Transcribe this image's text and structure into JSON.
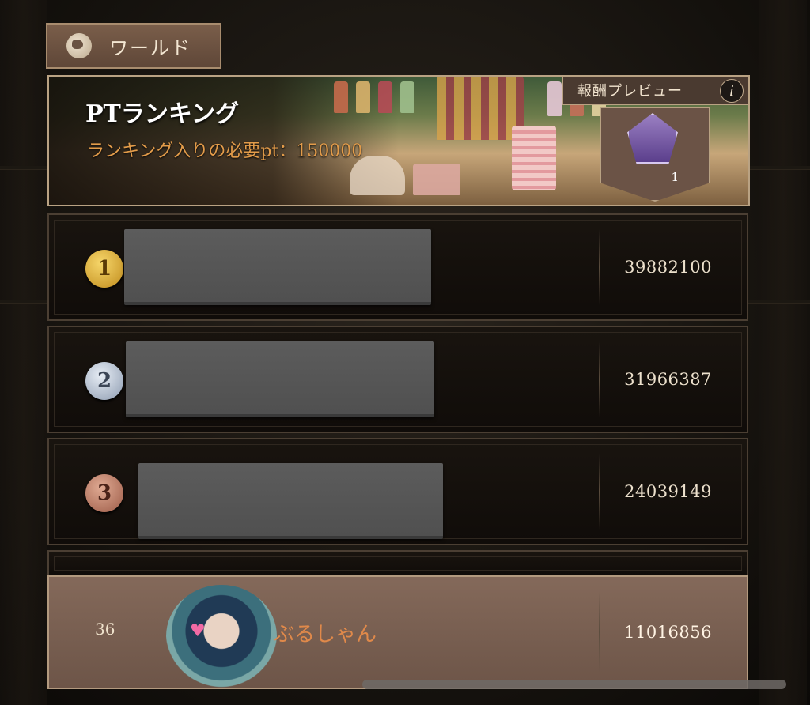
{
  "tab": {
    "label": "ワールド",
    "icon": "globe-icon"
  },
  "banner": {
    "title": "PTランキング",
    "subtitle": "ランキング入りの必要pt：150000",
    "reward_label": "報酬プレビュー",
    "info_glyph": "i",
    "reward_icon": "cake-badge-icon",
    "reward_count": "1"
  },
  "rankings": [
    {
      "rank": "1",
      "score": "39882100"
    },
    {
      "rank": "2",
      "score": "31966387"
    },
    {
      "rank": "3",
      "score": "24039149"
    }
  ],
  "self": {
    "rank": "36",
    "name": "ぶるしゃん",
    "score": "11016856"
  },
  "colors": {
    "accent_orange": "#e0894a",
    "banner_subtitle": "#e39c4a",
    "self_row_bg": "#7a5f50"
  }
}
